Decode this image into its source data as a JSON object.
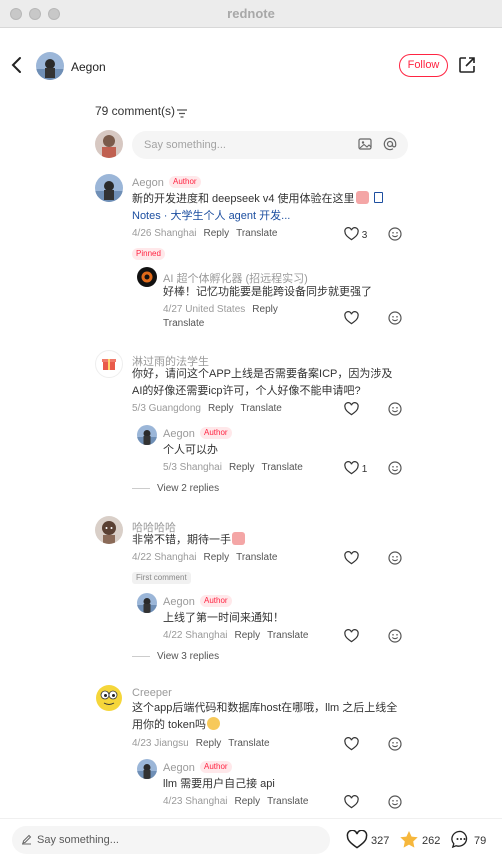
{
  "window": {
    "title": "rednote"
  },
  "header": {
    "author_name": "Aegon",
    "follow_label": "Follow"
  },
  "comments_header": {
    "count_label": "79 comment(s)"
  },
  "composer": {
    "placeholder": "Say something..."
  },
  "comments": [
    {
      "name": "Aegon",
      "tag": "Author",
      "text_line1": "新的开发进度和 deepseek v4 使用体验在这里",
      "text_link": "Notes · 大学生个人 agent 开发...",
      "date_loc": "4/26 Shanghai",
      "reply": "Reply",
      "translate": "Translate",
      "likes": "3",
      "badge": "Pinned",
      "replies": [
        {
          "name": "AI 超个体孵化器 (招远程实习)",
          "text": "好棒！记忆功能要是能跨设备同步就更强了",
          "date_loc": "4/27 United States",
          "reply": "Reply",
          "translate": "Translate"
        }
      ]
    },
    {
      "name": "淋过雨的法学生",
      "text_line1": "你好，请问这个APP上线是否需要备案ICP，因为涉及",
      "text_line2": "AI的好像还需要icp许可，个人好像不能申请吧?",
      "date_loc": "5/3 Guangdong",
      "reply": "Reply",
      "translate": "Translate",
      "replies": [
        {
          "name": "Aegon",
          "tag": "Author",
          "text": "个人可以办",
          "date_loc": "5/3 Shanghai",
          "reply": "Reply",
          "translate": "Translate",
          "likes": "1"
        }
      ],
      "expand_label": "View 2 replies"
    },
    {
      "name": "哈哈哈哈",
      "text_line1": "非常不错，期待一手",
      "date_loc": "4/22 Shanghai",
      "reply": "Reply",
      "translate": "Translate",
      "badge": "First comment",
      "replies": [
        {
          "name": "Aegon",
          "tag": "Author",
          "text": "上线了第一时间来通知！",
          "date_loc": "4/22 Shanghai",
          "reply": "Reply",
          "translate": "Translate"
        }
      ],
      "expand_label": "View 3 replies"
    },
    {
      "name": "Creeper",
      "text_line1": "这个app后端代码和数据库host在哪哦，llm 之后上线全",
      "text_line2": "用你的 token吗",
      "date_loc": "4/23 Jiangsu",
      "reply": "Reply",
      "translate": "Translate",
      "replies": [
        {
          "name": "Aegon",
          "tag": "Author",
          "text": "llm 需要用户自己接 api",
          "date_loc": "4/23 Shanghai",
          "reply": "Reply",
          "translate": "Translate"
        }
      ]
    }
  ],
  "bottom": {
    "placeholder": "Say something...",
    "likes": "327",
    "collects": "262",
    "comments": "79"
  },
  "colors": {
    "accent": "#ff2442",
    "link": "#1d4fa0",
    "star": "#f6b73c"
  },
  "icons": [
    "back-icon",
    "share-icon",
    "sort-icon",
    "image-icon",
    "at-icon",
    "heart-icon",
    "emoji-icon",
    "note-icon",
    "pencil-icon",
    "star-icon",
    "comment-icon"
  ]
}
